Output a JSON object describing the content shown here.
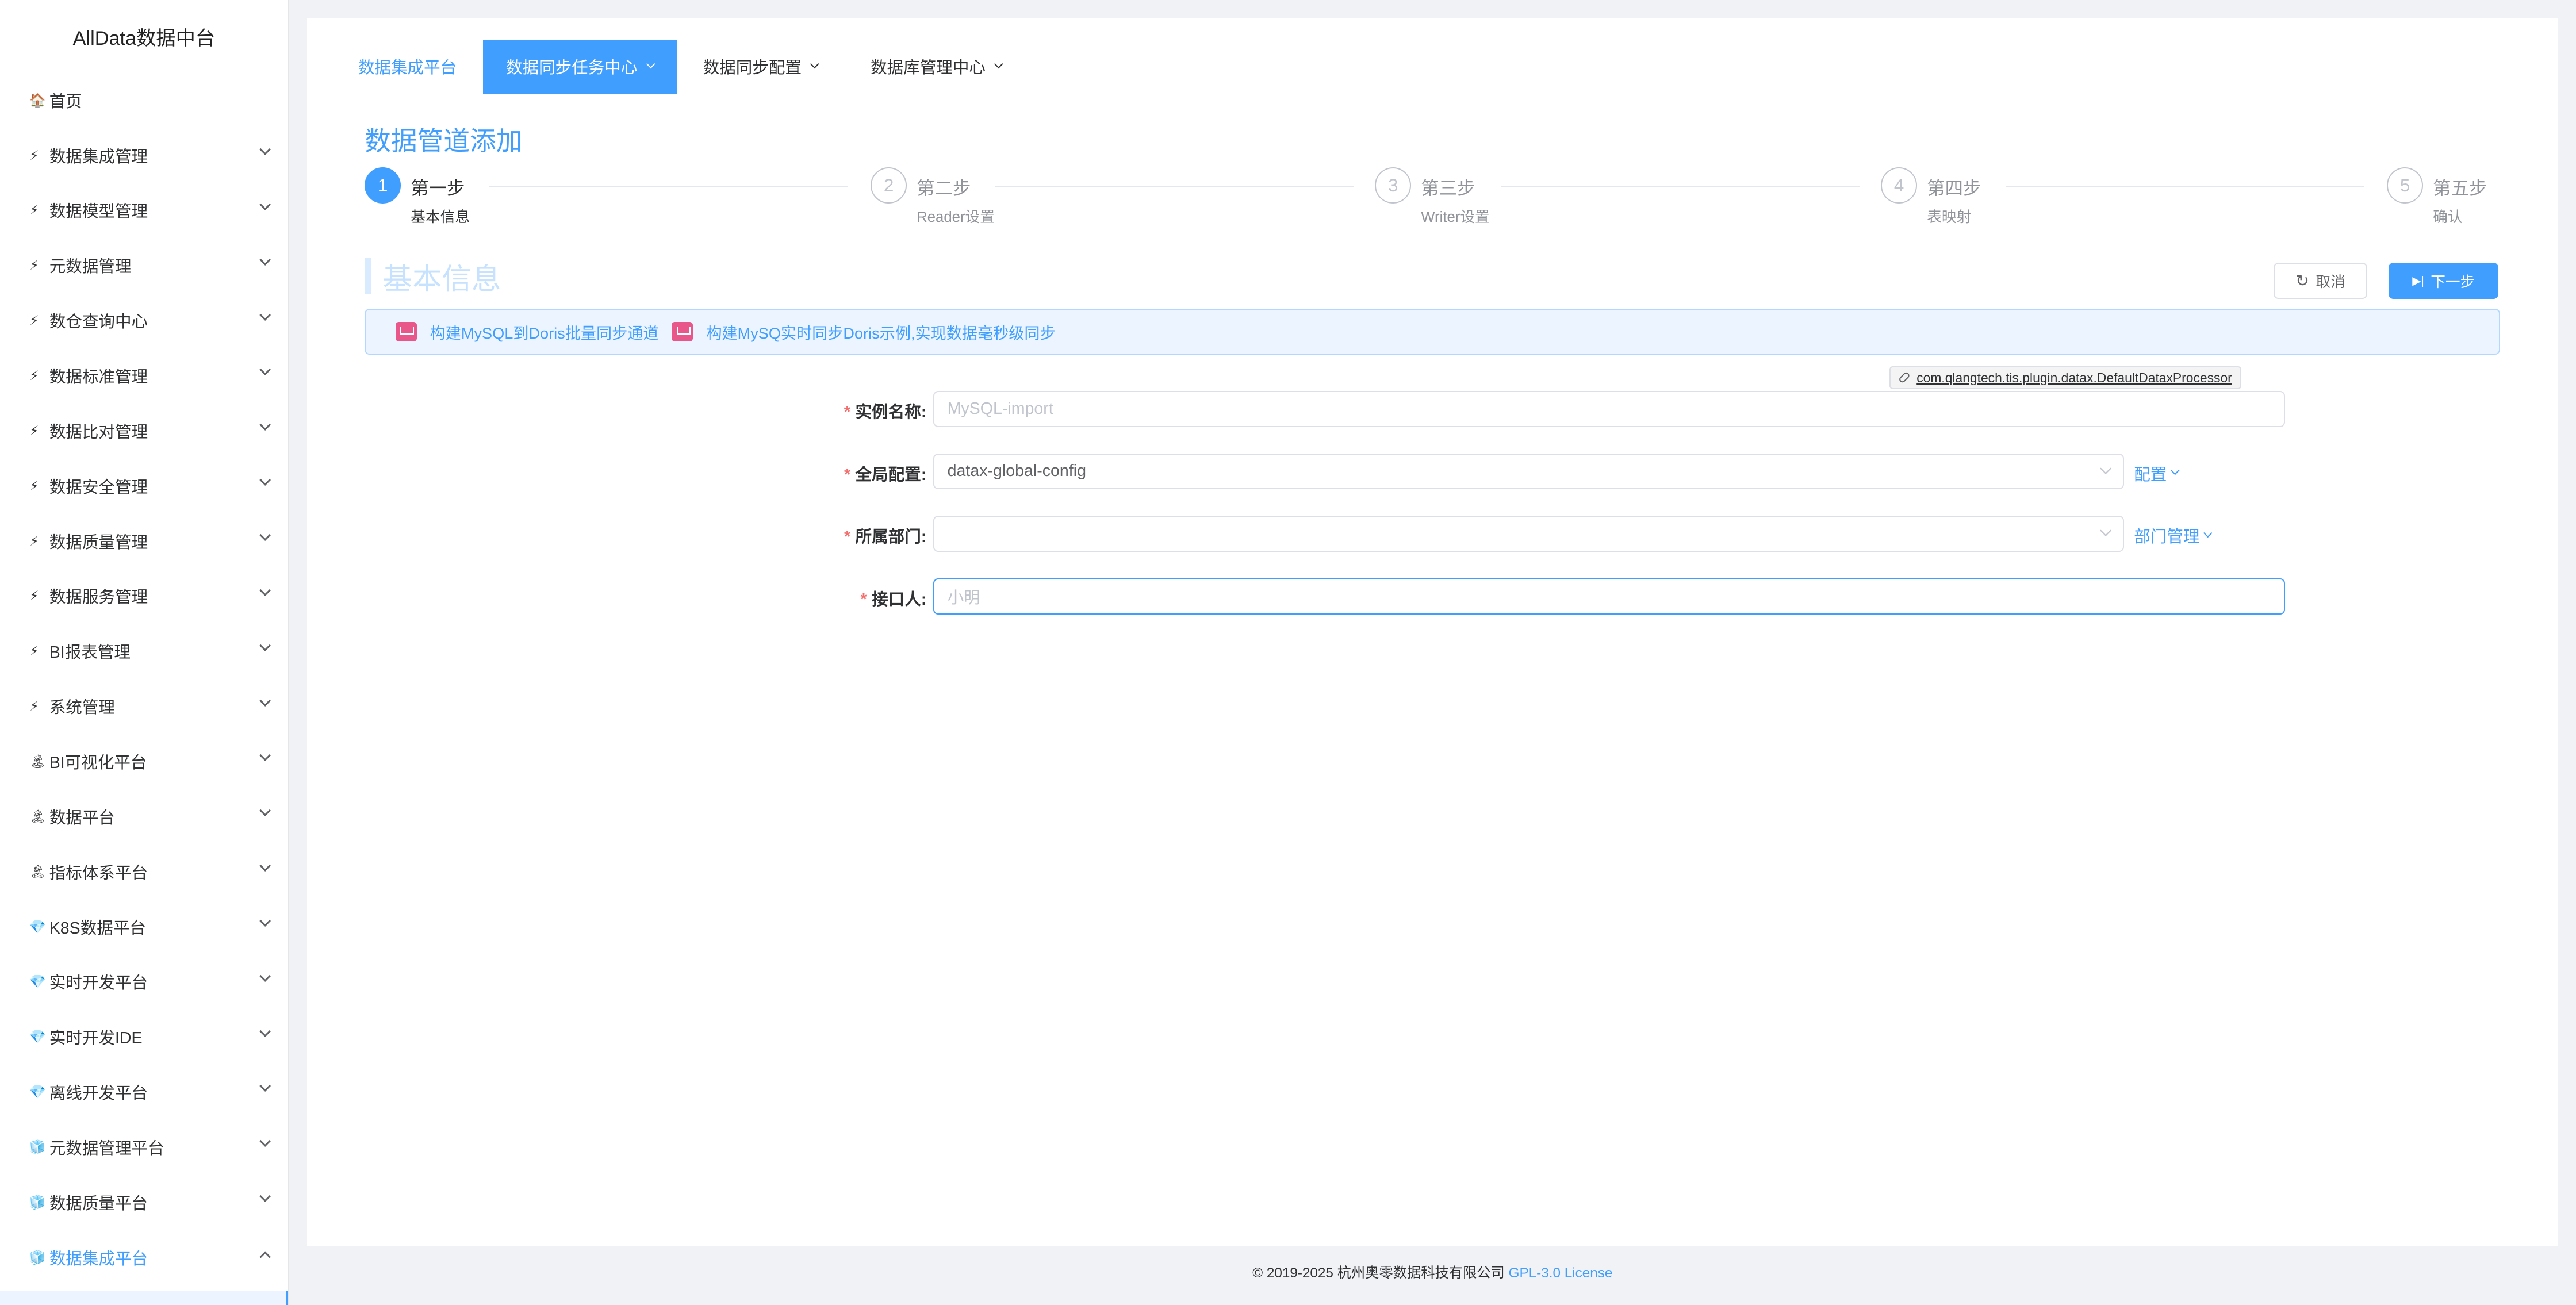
{
  "brand": "AllData数据中台",
  "sidebar": {
    "items": [
      {
        "icon": "🏠",
        "icon_name": "home-icon",
        "label": "首页",
        "expandable": false
      },
      {
        "icon": "⚡",
        "icon_name": "lightning-icon",
        "label": "数据集成管理",
        "expandable": true
      },
      {
        "icon": "⚡",
        "icon_name": "lightning-icon",
        "label": "数据模型管理",
        "expandable": true
      },
      {
        "icon": "⚡",
        "icon_name": "lightning-icon",
        "label": "元数据管理",
        "expandable": true
      },
      {
        "icon": "⚡",
        "icon_name": "lightning-icon",
        "label": "数仓查询中心",
        "expandable": true
      },
      {
        "icon": "⚡",
        "icon_name": "lightning-icon",
        "label": "数据标准管理",
        "expandable": true
      },
      {
        "icon": "⚡",
        "icon_name": "lightning-icon",
        "label": "数据比对管理",
        "expandable": true
      },
      {
        "icon": "⚡",
        "icon_name": "lightning-icon",
        "label": "数据安全管理",
        "expandable": true
      },
      {
        "icon": "⚡",
        "icon_name": "lightning-icon",
        "label": "数据质量管理",
        "expandable": true
      },
      {
        "icon": "⚡",
        "icon_name": "lightning-icon",
        "label": "数据服务管理",
        "expandable": true
      },
      {
        "icon": "⚡",
        "icon_name": "lightning-icon",
        "label": "BI报表管理",
        "expandable": true
      },
      {
        "icon": "⚡",
        "icon_name": "lightning-icon",
        "label": "系统管理",
        "expandable": true
      },
      {
        "icon": "🏝",
        "icon_name": "island-icon",
        "label": "BI可视化平台",
        "expandable": true
      },
      {
        "icon": "🏝",
        "icon_name": "island-icon",
        "label": "数据平台",
        "expandable": true
      },
      {
        "icon": "🏝",
        "icon_name": "island-icon",
        "label": "指标体系平台",
        "expandable": true
      },
      {
        "icon": "💎",
        "icon_name": "gem-icon",
        "label": "K8S数据平台",
        "expandable": true
      },
      {
        "icon": "💎",
        "icon_name": "gem-icon",
        "label": "实时开发平台",
        "expandable": true
      },
      {
        "icon": "💎",
        "icon_name": "gem-icon",
        "label": "实时开发IDE",
        "expandable": true
      },
      {
        "icon": "💎",
        "icon_name": "gem-icon",
        "label": "离线开发平台",
        "expandable": true
      },
      {
        "icon": "🧊",
        "icon_name": "cube-icon",
        "label": "元数据管理平台",
        "expandable": true
      },
      {
        "icon": "🧊",
        "icon_name": "cube-icon",
        "label": "数据质量平台",
        "expandable": true
      },
      {
        "icon": "🧊",
        "icon_name": "cube-icon",
        "label": "数据集成平台",
        "expandable": true,
        "active": true
      }
    ]
  },
  "topnav": {
    "home": "数据集成平台",
    "tabs": [
      {
        "label": "数据同步任务中心",
        "active": true
      },
      {
        "label": "数据同步配置",
        "active": false
      },
      {
        "label": "数据库管理中心",
        "active": false
      }
    ]
  },
  "page_title": "数据管道添加",
  "steps": [
    {
      "num": "1",
      "title": "第一步",
      "desc": "基本信息",
      "state": "done"
    },
    {
      "num": "2",
      "title": "第二步",
      "desc": "Reader设置",
      "state": "wait"
    },
    {
      "num": "3",
      "title": "第三步",
      "desc": "Writer设置",
      "state": "wait"
    },
    {
      "num": "4",
      "title": "第四步",
      "desc": "表映射",
      "state": "wait"
    },
    {
      "num": "5",
      "title": "第五步",
      "desc": "确认",
      "state": "wait"
    }
  ],
  "section_title": "基本信息",
  "buttons": {
    "cancel": "取消",
    "next": "下一步"
  },
  "alert_links": [
    "构建MySQL到Doris批量同步通道",
    "构建MySQ实时同步Doris示例,实现数据毫秒级同步"
  ],
  "processor_tag": "com.qlangtech.tis.plugin.datax.DefaultDataxProcessor",
  "form": {
    "instance_name": {
      "label": "实例名称",
      "placeholder": "MySQL-import",
      "value": ""
    },
    "global_config": {
      "label": "全局配置",
      "value": "datax-global-config",
      "link": "配置"
    },
    "department": {
      "label": "所属部门",
      "value": "",
      "link": "部门管理"
    },
    "contact": {
      "label": "接口人",
      "placeholder": "小明",
      "value": ""
    }
  },
  "footer": {
    "copyright": "© 2019-2025 杭州奥零数据科技有限公司",
    "license": "GPL-3.0 License"
  },
  "colors": {
    "primary": "#409eff",
    "required": "#f56c6c",
    "alert_bg": "#ecf5ff"
  }
}
